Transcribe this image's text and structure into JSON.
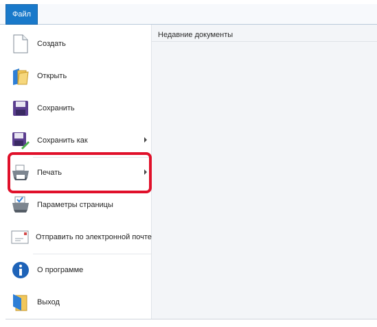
{
  "ribbon": {
    "file_tab_label": "Файл"
  },
  "menu": {
    "items": [
      {
        "label": "Создать",
        "icon": "new-document-icon",
        "has_submenu": false
      },
      {
        "label": "Открыть",
        "icon": "open-folder-icon",
        "has_submenu": false
      },
      {
        "label": "Сохранить",
        "icon": "save-floppy-icon",
        "has_submenu": false
      },
      {
        "label": "Сохранить как",
        "icon": "save-as-icon",
        "has_submenu": true
      },
      {
        "label": "Печать",
        "icon": "printer-icon",
        "has_submenu": true
      },
      {
        "label": "Параметры страницы",
        "icon": "page-setup-icon",
        "has_submenu": false
      },
      {
        "label": "Отправить по электронной почте",
        "icon": "email-envelope-icon",
        "has_submenu": false
      },
      {
        "label": "О программе",
        "icon": "info-icon",
        "has_submenu": false
      },
      {
        "label": "Выход",
        "icon": "exit-icon",
        "has_submenu": false
      }
    ],
    "highlighted_item": "Печать",
    "highlight_color": "#e0102a"
  },
  "recent": {
    "title": "Недавние документы"
  },
  "colors": {
    "file_tab": "#1979ca",
    "right_panel": "#f3f5f8"
  }
}
